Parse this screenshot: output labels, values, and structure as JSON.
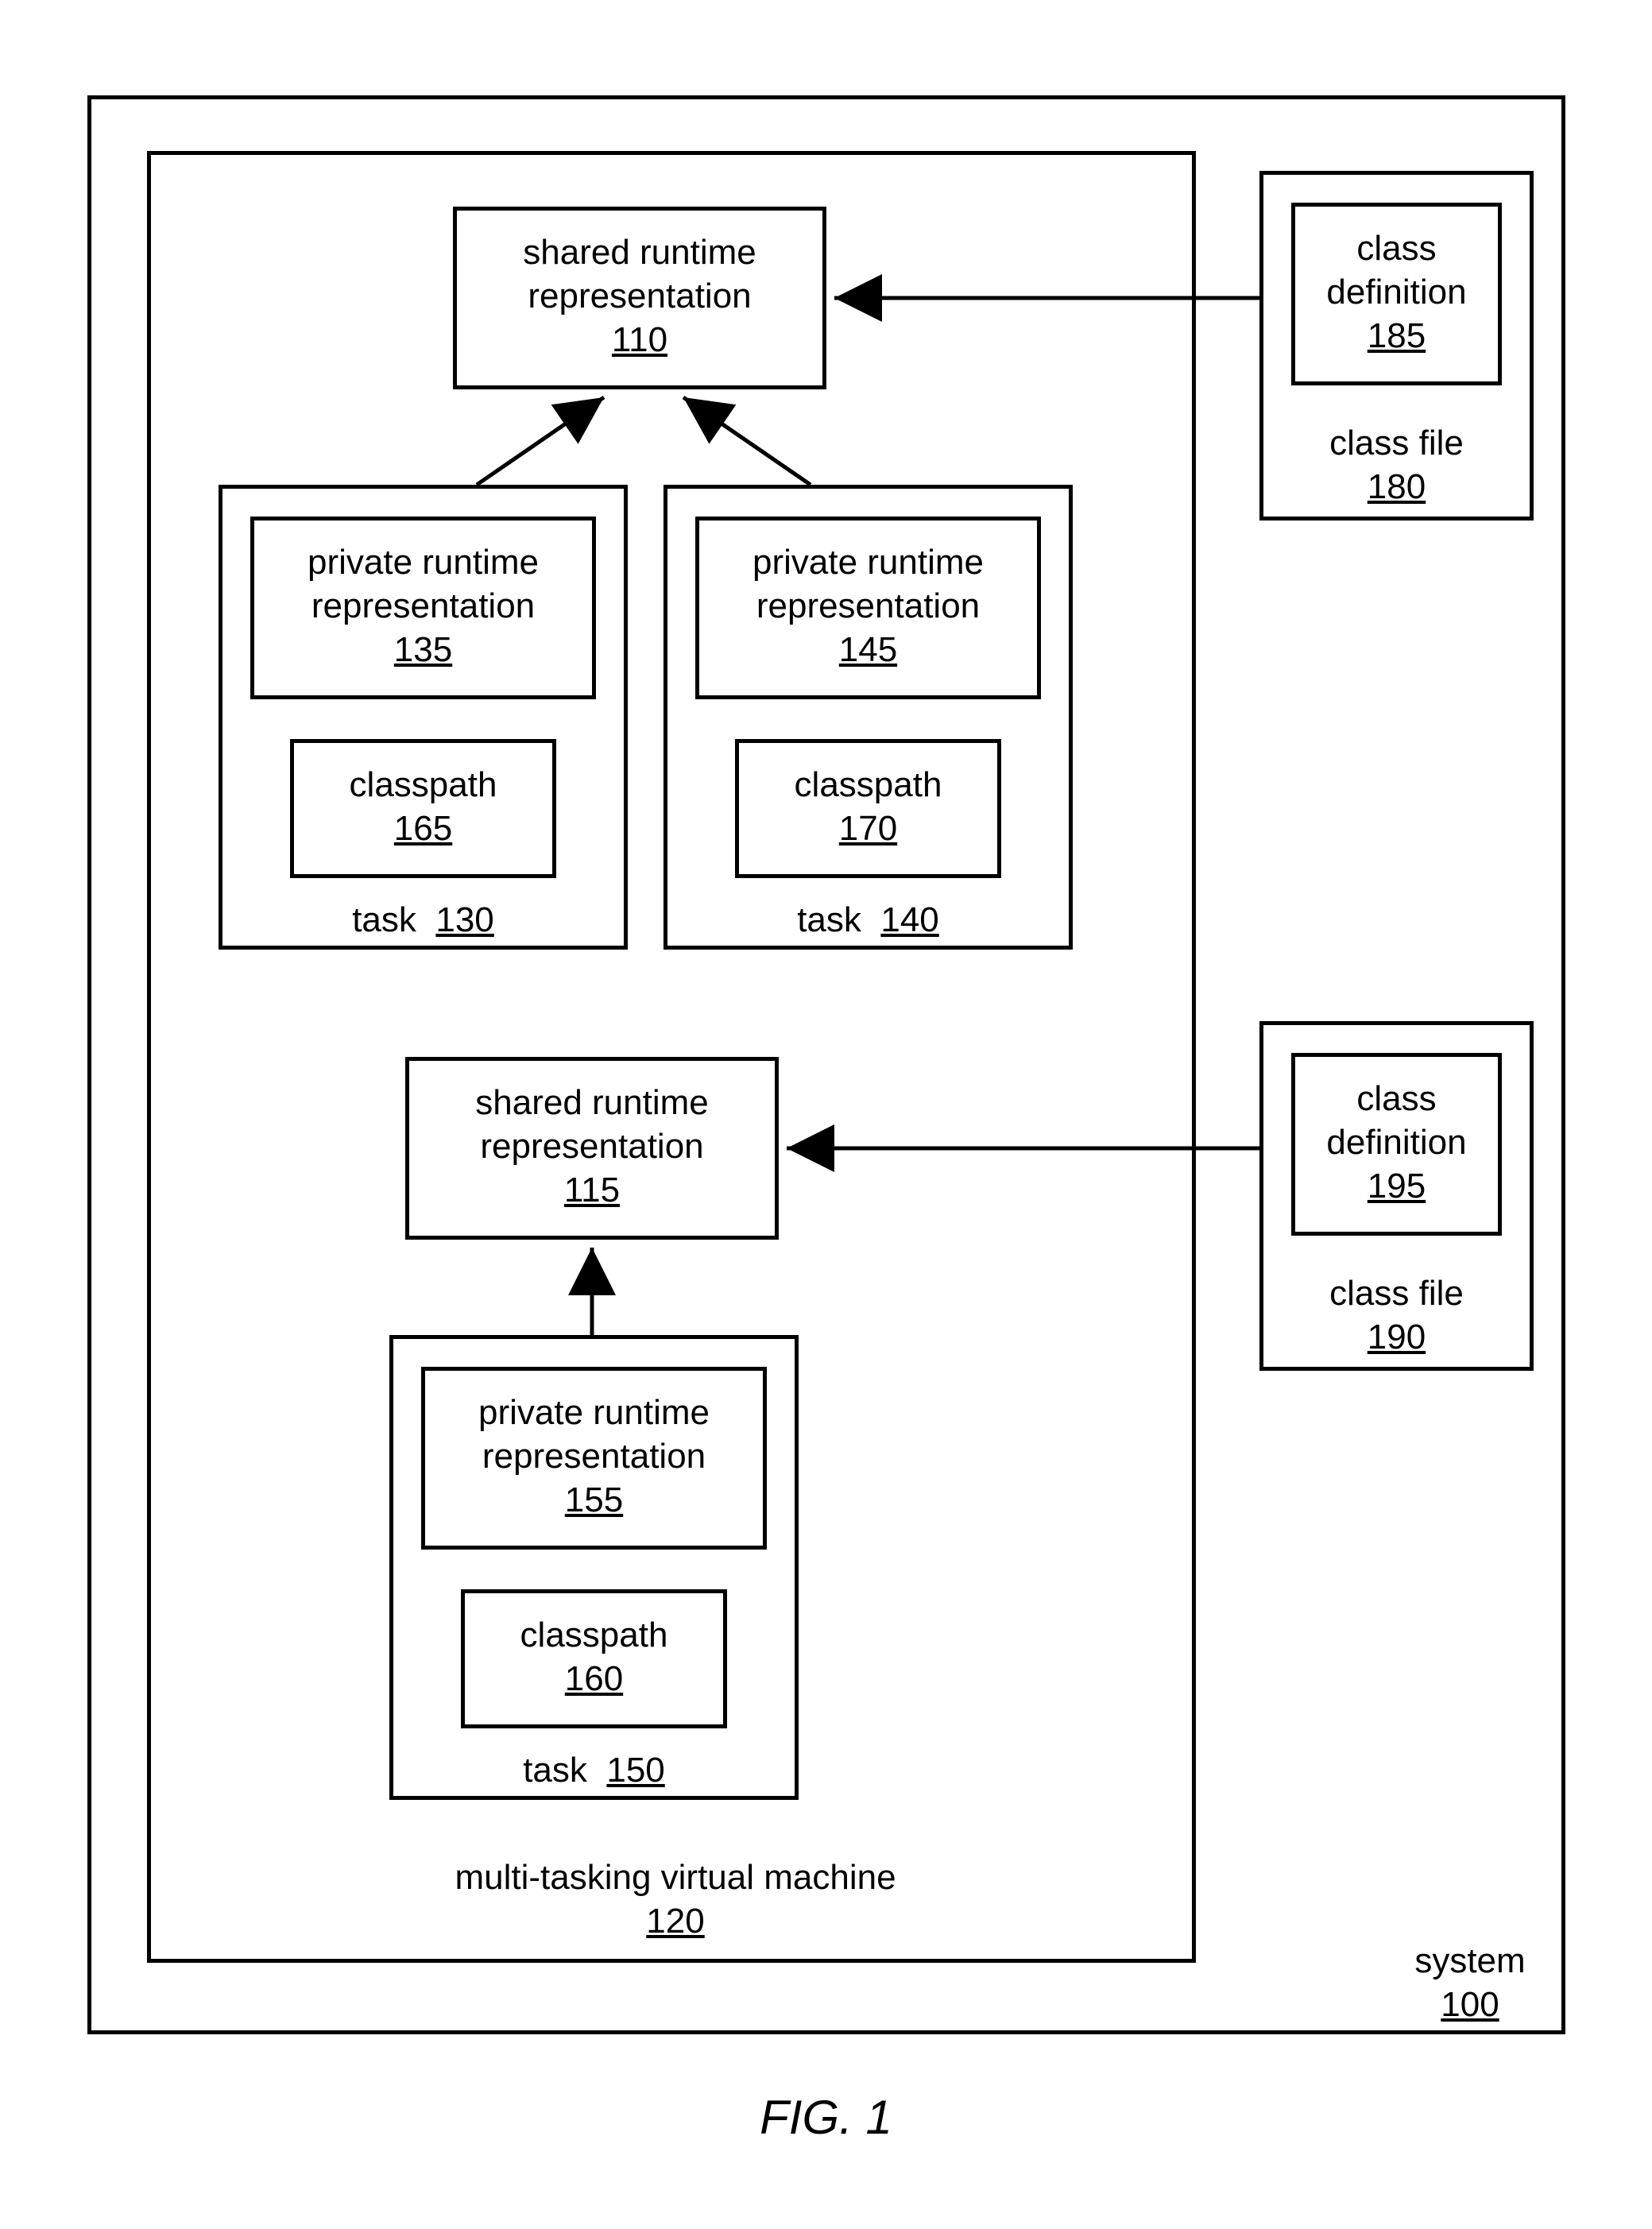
{
  "figure_caption": "FIG. 1",
  "system": {
    "label": "system",
    "id": "100"
  },
  "vm": {
    "label": "multi-tasking virtual machine",
    "id": "120"
  },
  "shared_runtime_1": {
    "line1": "shared runtime",
    "line2": "representation",
    "id": "110"
  },
  "shared_runtime_2": {
    "line1": "shared runtime",
    "line2": "representation",
    "id": "115"
  },
  "task1": {
    "label": "task",
    "id": "130"
  },
  "task2": {
    "label": "task",
    "id": "140"
  },
  "task3": {
    "label": "task",
    "id": "150"
  },
  "priv1": {
    "line1": "private runtime",
    "line2": "representation",
    "id": "135"
  },
  "priv2": {
    "line1": "private runtime",
    "line2": "representation",
    "id": "145"
  },
  "priv3": {
    "line1": "private runtime",
    "line2": "representation",
    "id": "155"
  },
  "cp1": {
    "label": "classpath",
    "id": "165"
  },
  "cp2": {
    "label": "classpath",
    "id": "170"
  },
  "cp3": {
    "label": "classpath",
    "id": "160"
  },
  "classfile1": {
    "label": "class file",
    "id": "180"
  },
  "classfile2": {
    "label": "class file",
    "id": "190"
  },
  "classdef1": {
    "line1": "class",
    "line2": "definition",
    "id": "185"
  },
  "classdef2": {
    "line1": "class",
    "line2": "definition",
    "id": "195"
  }
}
